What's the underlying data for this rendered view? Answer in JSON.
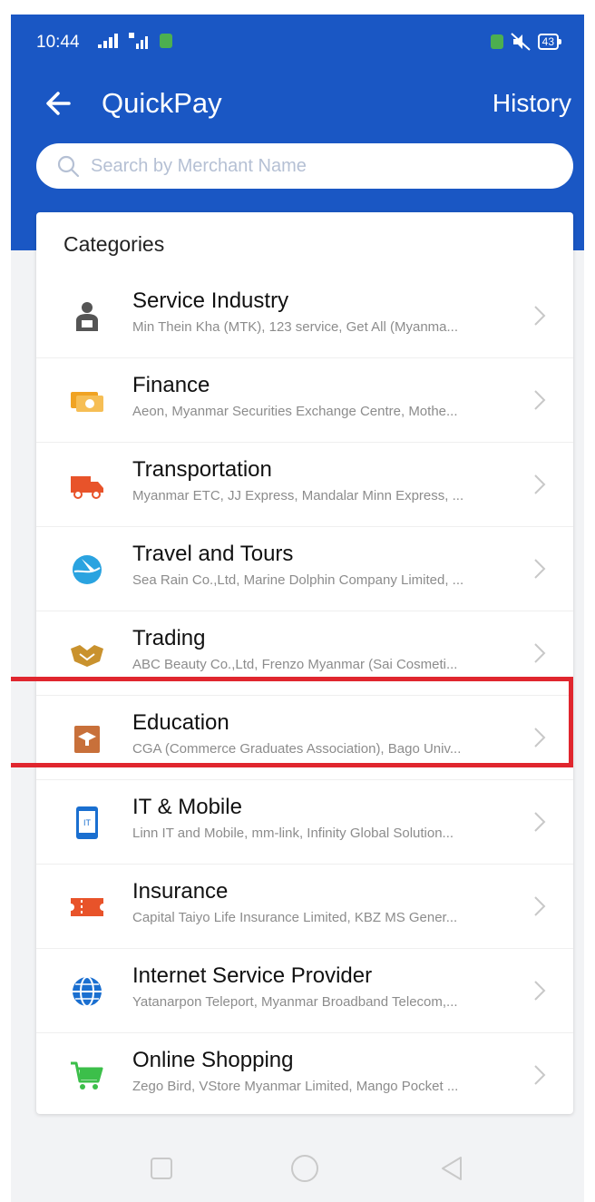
{
  "status": {
    "time": "10:44",
    "battery": "43"
  },
  "toolbar": {
    "title": "QuickPay",
    "history": "History"
  },
  "search": {
    "placeholder": "Search by Merchant Name"
  },
  "categories": {
    "heading": "Categories",
    "items": [
      {
        "name": "Service Industry",
        "desc": "Min Thein Kha (MTK), 123 service, Get All (Myanma...",
        "icon": "person-desk-icon",
        "color": "#555555"
      },
      {
        "name": "Finance",
        "desc": "Aeon, Myanmar Securities Exchange Centre, Mothe...",
        "icon": "money-icon",
        "color": "#f0a323"
      },
      {
        "name": "Transportation",
        "desc": "Myanmar ETC, JJ Express, Mandalar Minn Express, ...",
        "icon": "truck-icon",
        "color": "#e8532a"
      },
      {
        "name": "Travel and Tours",
        "desc": "Sea Rain Co.,Ltd, Marine Dolphin Company Limited, ...",
        "icon": "globe-plane-icon",
        "color": "#2aa3e0"
      },
      {
        "name": "Trading",
        "desc": "ABC Beauty Co.,Ltd, Frenzo Myanmar (Sai Cosmeti...",
        "icon": "handshake-icon",
        "color": "#c9922e"
      },
      {
        "name": "Education",
        "desc": "CGA (Commerce Graduates Association), Bago Univ...",
        "icon": "graduation-book-icon",
        "color": "#c8703a"
      },
      {
        "name": "IT & Mobile",
        "desc": "Linn IT and Mobile, mm-link, Infinity Global Solution...",
        "icon": "mobile-icon",
        "color": "#1a6fd0"
      },
      {
        "name": "Insurance",
        "desc": "Capital Taiyo Life Insurance Limited, KBZ MS Gener...",
        "icon": "ticket-icon",
        "color": "#e8532a"
      },
      {
        "name": "Internet Service Provider",
        "desc": "Yatanarpon Teleport, Myanmar Broadband Telecom,...",
        "icon": "globe-icon",
        "color": "#1a6fd0"
      },
      {
        "name": "Online Shopping",
        "desc": "Zego Bird, VStore Myanmar Limited, Mango Pocket ...",
        "icon": "cart-icon",
        "color": "#3cbf4a"
      }
    ]
  },
  "colors": {
    "header": "#1a57c4",
    "highlight": "#e0262e"
  }
}
